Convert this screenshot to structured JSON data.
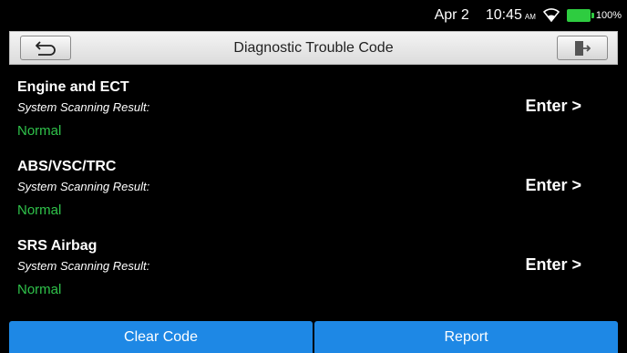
{
  "status_bar": {
    "date": "Apr 2",
    "time": "10:45",
    "ampm": "AM",
    "battery": "100%",
    "icons": [
      "wifi-icon",
      "battery-icon"
    ]
  },
  "header": {
    "title": "Diagnostic Trouble Code",
    "left_icon": "back-arrow-icon",
    "right_icon": "exit-icon"
  },
  "systems": [
    {
      "name": "Engine and ECT",
      "subtitle": "System Scanning Result:",
      "status": "Normal",
      "action": "Enter >"
    },
    {
      "name": "ABS/VSC/TRC",
      "subtitle": "System Scanning Result:",
      "status": "Normal",
      "action": "Enter >"
    },
    {
      "name": "SRS Airbag",
      "subtitle": "System Scanning Result:",
      "status": "Normal",
      "action": "Enter >"
    }
  ],
  "footer": {
    "clear_label": "Clear Code",
    "report_label": "Report"
  },
  "colors": {
    "background": "#000000",
    "normal_status": "#2fc24a",
    "button_blue": "#1e88e5",
    "battery": "#2ecc40"
  }
}
